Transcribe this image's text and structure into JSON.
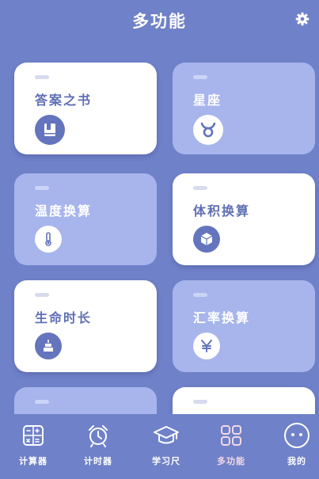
{
  "header": {
    "title": "多功能",
    "settings_icon": "gear-icon"
  },
  "cards": [
    {
      "label": "答案之书",
      "style": "white",
      "icon": "book-icon"
    },
    {
      "label": "星座",
      "style": "blue",
      "icon": "taurus-icon"
    },
    {
      "label": "温度换算",
      "style": "blue",
      "icon": "thermometer-icon"
    },
    {
      "label": "体积换算",
      "style": "white",
      "icon": "cube-icon"
    },
    {
      "label": "生命时长",
      "style": "white",
      "icon": "cake-icon"
    },
    {
      "label": "汇率换算",
      "style": "blue",
      "icon": "yen-icon"
    }
  ],
  "tabbar": {
    "tabs": [
      {
        "label": "计算器",
        "icon": "calculator-icon",
        "active": false
      },
      {
        "label": "计时器",
        "icon": "alarm-clock-icon",
        "active": false
      },
      {
        "label": "学习尺",
        "icon": "graduation-cap-icon",
        "active": false
      },
      {
        "label": "多功能",
        "icon": "grid-icon",
        "active": true
      },
      {
        "label": "我的",
        "icon": "smiley-icon",
        "active": false
      }
    ]
  },
  "colors": {
    "background": "#6f81c8",
    "card_white": "#ffffff",
    "card_blue": "#a7b5ec",
    "accent": "#6474bd",
    "active_tab": "#f3d9e6"
  }
}
